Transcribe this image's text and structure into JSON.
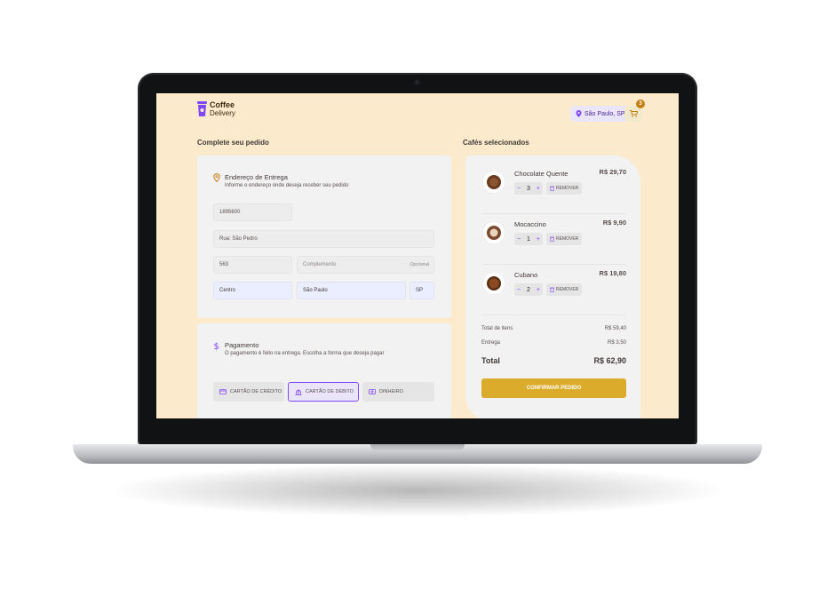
{
  "header": {
    "logo_line1": "Coffee",
    "logo_line2": "Delivery",
    "location": "São Paulo, SP",
    "cart_count": "3"
  },
  "checkout": {
    "title": "Complete seu pedido",
    "address": {
      "title": "Endereço de Entrega",
      "subtitle": "Informe o endereço onde deseja receber seu pedido",
      "cep": "1895600",
      "street": "Rua: São Pedro",
      "number": "563",
      "complement_placeholder": "Complemento",
      "complement_optional": "Opcional",
      "district": "Centro",
      "city": "São Paulo",
      "uf": "SP"
    },
    "payment": {
      "title": "Pagamento",
      "subtitle": "O pagamento é feito na entrega. Escolha a forma que deseja pagar",
      "options": [
        "CARTÃO DE CRÉDITO",
        "CARTÃO DE DÉBITO",
        "DINHEIRO"
      ],
      "selected": "CARTÃO DE DÉBITO"
    }
  },
  "summary": {
    "title": "Cafés selecionados",
    "items": [
      {
        "name": "Chocolate Quente",
        "price": "R$ 29,70",
        "qty": "3"
      },
      {
        "name": "Mocaccino",
        "price": "R$ 9,90",
        "qty": "1"
      },
      {
        "name": "Cubano",
        "price": "R$ 19,80",
        "qty": "2"
      }
    ],
    "minus": "−",
    "plus": "+",
    "remove_label": "REMOVER",
    "items_total_label": "Total de itens",
    "items_total": "R$ 59,40",
    "delivery_label": "Entrega",
    "delivery": "R$ 3,50",
    "total_label": "Total",
    "total": "R$ 62,90",
    "confirm_label": "CONFIRMAR PEDIDO"
  },
  "colors": {
    "purple": "#8047f8",
    "yellow": "#dbac2c",
    "yellow_dark": "#c47f17",
    "background": "#fbeacb"
  }
}
